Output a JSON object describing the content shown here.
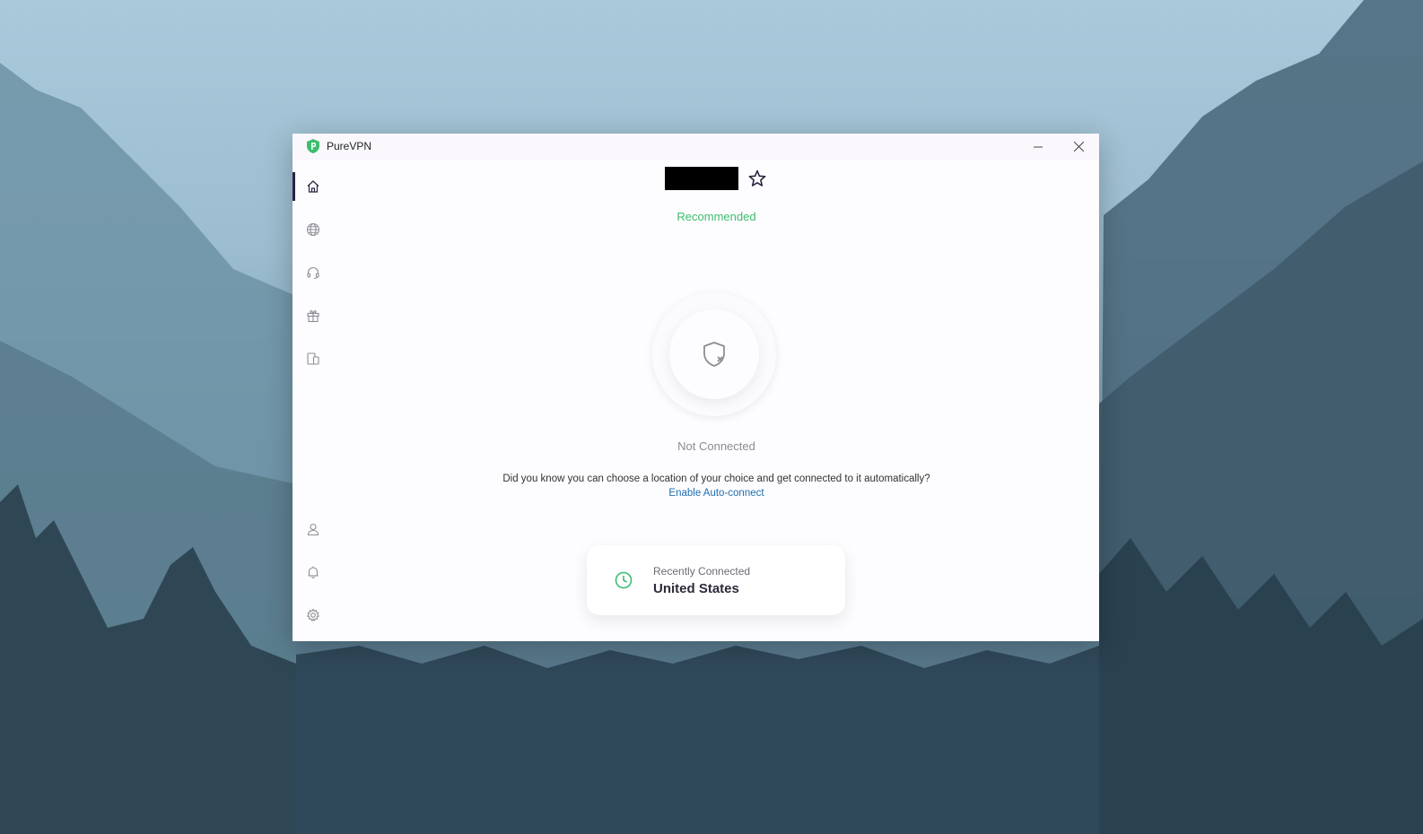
{
  "window": {
    "title": "PureVPN"
  },
  "sidebar": {
    "items": [
      {
        "name": "home",
        "icon": "home-icon",
        "active": true
      },
      {
        "name": "locations",
        "icon": "globe-icon",
        "active": false
      },
      {
        "name": "support",
        "icon": "headset-icon",
        "active": false
      },
      {
        "name": "rewards",
        "icon": "gift-icon",
        "active": false
      },
      {
        "name": "devices",
        "icon": "devices-icon",
        "active": false
      },
      {
        "name": "account",
        "icon": "user-icon",
        "active": false
      },
      {
        "name": "notifications",
        "icon": "bell-icon",
        "active": false
      },
      {
        "name": "settings",
        "icon": "gear-icon",
        "active": false
      }
    ]
  },
  "main": {
    "server_label": "",
    "recommended": "Recommended",
    "status": "Not Connected",
    "tip": "Did you know you can choose a location of your choice and get connected to it automatically?",
    "tip_link": "Enable Auto-connect",
    "recent": {
      "label": "Recently Connected",
      "value": "United States"
    }
  },
  "colors": {
    "accent_green": "#3dbd6e",
    "link_blue": "#1f6fb0",
    "active_indicator": "#2b2440"
  }
}
